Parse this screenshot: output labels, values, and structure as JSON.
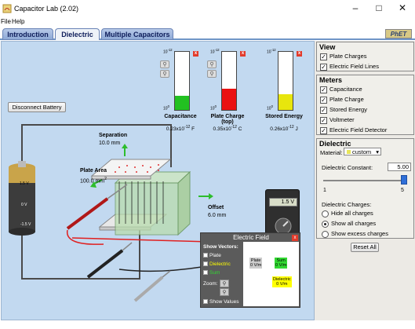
{
  "window": {
    "title": "Capacitor Lab (2.02)"
  },
  "menu": {
    "file": "File",
    "help": "Help"
  },
  "tabs": [
    {
      "label": "Introduction",
      "active": false
    },
    {
      "label": "Dielectric",
      "active": true
    },
    {
      "label": "Multiple Capacitors",
      "active": false
    }
  ],
  "logo": {
    "text": "PhET"
  },
  "sim": {
    "disconnect_button": "Disconnect Battery",
    "separation": {
      "label": "Separation",
      "value": "10.0 mm"
    },
    "plate_area": {
      "label": "Plate Area",
      "value": "100.0 mm",
      "exp": "2"
    },
    "offset": {
      "label": "Offset",
      "value": "6.0 mm"
    },
    "battery": {
      "top": "1.5 V",
      "mid": "0 V",
      "bottom": "-1.5 V"
    },
    "voltmeter": {
      "reading": "1.5 V"
    },
    "bar_meters": [
      {
        "label": "Capacitance",
        "mantissa": "0.23x10",
        "exp": "-12",
        "unit": "F",
        "top_exp": "-12",
        "bot_exp": "0",
        "color": "#22c121",
        "level": 0.24
      },
      {
        "label": "Plate Charge (top)",
        "mantissa": "0.35x10",
        "exp": "-12",
        "unit": "C",
        "top_exp": "-12",
        "bot_exp": "0",
        "color": "#ea1111",
        "level": 0.36
      },
      {
        "label": "Stored Energy",
        "mantissa": "0.26x10",
        "exp": "-12",
        "unit": "J",
        "top_exp": "-12",
        "bot_exp": "0",
        "color": "#e8e60d",
        "level": 0.27
      }
    ],
    "efield": {
      "title": "Electric Field",
      "show_vectors": "Show Vectors:",
      "plate": "Plate",
      "dielectric": "Dielectric",
      "sum": "Sum",
      "zoom": "Zoom:",
      "show_values": "Show Values",
      "plate_vec": {
        "name": "Plate",
        "value": "0 V/m"
      },
      "sum_vec": {
        "name": "Sum",
        "value": "0 V/m"
      },
      "dielectric_vec": {
        "name": "Dielectric",
        "value": "0 V/m"
      },
      "colors": {
        "plate": "#cccccc",
        "dielectric": "#ffff00",
        "sum": "#32d932"
      }
    }
  },
  "controls": {
    "view": {
      "title": "View",
      "items": [
        {
          "label": "Plate Charges",
          "checked": true
        },
        {
          "label": "Electric Field Lines",
          "checked": true
        }
      ]
    },
    "meters": {
      "title": "Meters",
      "items": [
        {
          "label": "Capacitance",
          "checked": true
        },
        {
          "label": "Plate Charge",
          "checked": true
        },
        {
          "label": "Stored Energy",
          "checked": true
        },
        {
          "label": "Voltmeter",
          "checked": true
        },
        {
          "label": "Electric Field Detector",
          "checked": true
        }
      ]
    },
    "dielectric": {
      "title": "Dielectric",
      "material_label": "Material:",
      "material_value": "custom",
      "constant_label": "Dielectric Constant:",
      "constant_value": "5.00",
      "slider_min": "1",
      "slider_max": "5",
      "slider_level": 1.0,
      "charges_label": "Dielectric Charges:",
      "charge_options": [
        {
          "label": "Hide all charges",
          "selected": false
        },
        {
          "label": "Show all charges",
          "selected": true
        },
        {
          "label": "Show excess charges",
          "selected": false
        }
      ]
    },
    "reset_button": "Reset All"
  }
}
